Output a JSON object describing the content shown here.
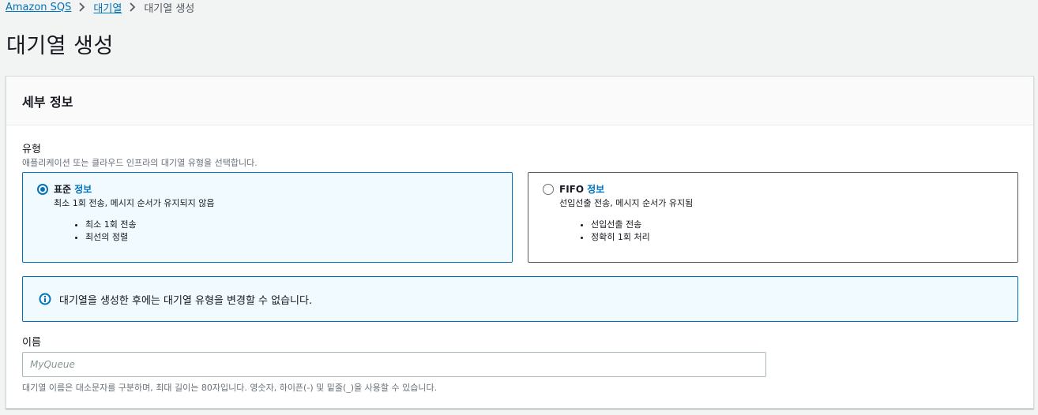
{
  "breadcrumb": {
    "root": "Amazon SQS",
    "parent": "대기열",
    "current": "대기열 생성"
  },
  "page_title": "대기열 생성",
  "panel": {
    "title": "세부 정보",
    "type_field": {
      "label": "유형",
      "description": "애플리케이션 또는 클라우드 인프라의 대기열 유형을 선택합니다.",
      "options": [
        {
          "title": "표준",
          "info": "정보",
          "description": "최소 1회 전송, 메시지 순서가 유지되지 않음",
          "bullets": [
            "최소 1회 전송",
            "최선의 정렬"
          ],
          "selected": true
        },
        {
          "title": "FIFO",
          "info": "정보",
          "description": "선입선출 전송, 메시지 순서가 유지됨",
          "bullets": [
            "선입선출 전송",
            "정확히 1회 처리"
          ],
          "selected": false
        }
      ]
    },
    "info_alert": "대기열을 생성한 후에는 대기열 유형을 변경할 수 없습니다.",
    "name_field": {
      "label": "이름",
      "placeholder": "MyQueue",
      "value": "",
      "constraint": "대기열 이름은 대소문자를 구분하며, 최대 길이는 80자입니다. 영숫자, 하이픈(-) 및 밑줄(_)을 사용할 수 있습니다."
    }
  },
  "colors": {
    "link": "#0073bb",
    "selected_tile_bg": "#f1faff",
    "page_bg": "#f2f3f3"
  }
}
